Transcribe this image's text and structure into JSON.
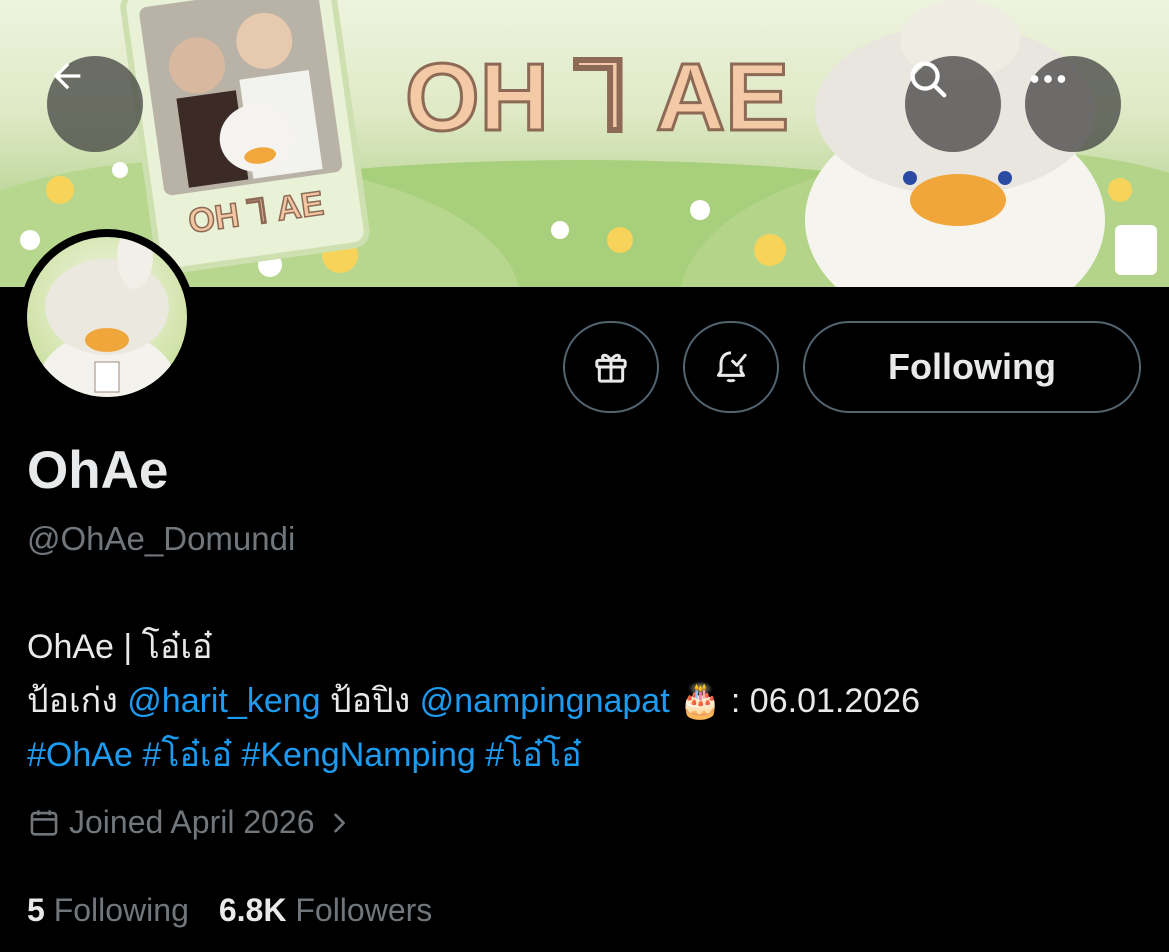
{
  "header": {
    "back_icon": "arrow-left-icon",
    "search_icon": "search-icon",
    "more_icon": "more-horizontal-icon",
    "banner_logo_text": "OH ꓶ AE",
    "banner_card_text": "OH ꓶ AE"
  },
  "profile": {
    "display_name": "OhAe",
    "handle": "@OhAe_Domundi",
    "bio_line1": "OhAe | โอ๋เอ๋",
    "bio_line2_a": "ป้อเก่ง ",
    "bio_mention1": "@harit_keng",
    "bio_line2_b": " ป้อปิง ",
    "bio_mention2": "@nampingnapat",
    "bio_emoji": "🎂",
    "bio_date": " : 06.01.2026",
    "hashtags": [
      "#OhAe",
      "#โอ๋เอ๋",
      "#KengNamping",
      "#โอ๋โอ๋"
    ],
    "joined": "Joined April 2026",
    "following_count": "5",
    "following_label": "Following",
    "followers_count": "6.8K",
    "followers_label": "Followers"
  },
  "actions": {
    "gift_icon": "gift-icon",
    "notify_icon": "bell-check-icon",
    "follow_label": "Following"
  },
  "colors": {
    "background": "#000000",
    "text": "#e7e9ea",
    "muted": "#71767b",
    "link": "#1d9bf0",
    "border": "#536471"
  }
}
